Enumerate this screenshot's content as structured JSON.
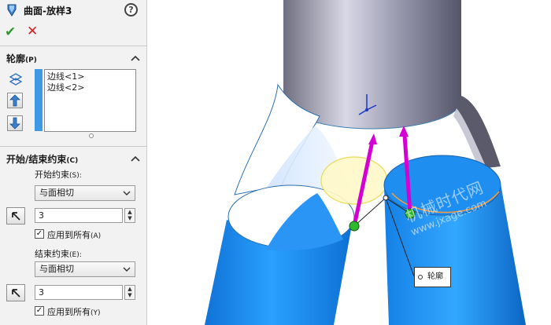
{
  "panel": {
    "title": "曲面-放样3",
    "icons": {
      "feature": "loft-surface-icon",
      "help": "help-icon",
      "ok": "checkmark-icon",
      "cancel": "x-icon"
    },
    "help_glyph": "?",
    "ok_glyph": "✔",
    "cancel_glyph": "✕"
  },
  "profiles": {
    "header": "轮廓",
    "header_key": "(P)",
    "items": [
      "边线<1>",
      "边线<2>"
    ]
  },
  "constraints": {
    "header": "开始/结束约束",
    "header_key": "(C)",
    "start_label": "开始约束",
    "start_key": "(S):",
    "start_value": "与面相切",
    "start_amount": "3",
    "start_apply_label": "应用到所有",
    "start_apply_key": "(A)",
    "start_apply_checked": true,
    "end_label": "结束约束",
    "end_key": "(E):",
    "end_value": "与面相切",
    "end_amount": "3",
    "end_apply_label": "应用到所有",
    "end_apply_key": "(Y)",
    "end_apply_checked": true
  },
  "viewport": {
    "callout_label": "轮廓",
    "watermark_main": "机械时代网",
    "watermark_url": "www.jxage.com"
  },
  "colors": {
    "accent_blue": "#3f9ae6",
    "tube_blue": "#1e90f0",
    "top_cylinder": "#8e8ea4",
    "connector_magenta": "#d400d4",
    "handle_green": "#2eb82e",
    "ok_green": "#2d9a2d",
    "cancel_red": "#d42020"
  }
}
